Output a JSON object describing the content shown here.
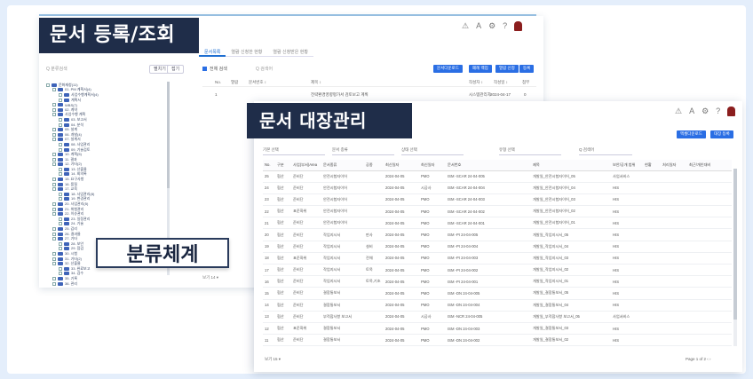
{
  "labels": {
    "doc_register": "문서 등록/조회",
    "doc_ledger": "문서 대장관리",
    "classification": "분류체계"
  },
  "back_window": {
    "tabs": [
      "문서목록",
      "열람 신청한 현황",
      "열람 신청받은 현황"
    ],
    "left_search_placeholder": "Q 분류검색",
    "left_buttons": [
      "펼치기",
      "접기"
    ],
    "toolbar": {
      "select_all": "전체 검색",
      "search_placeholder": "Q 검색어",
      "buttons": [
        "문서다운로드",
        "폐례 백업",
        "열람 신청",
        "등록"
      ]
    },
    "table_headers": [
      "No.",
      "열람",
      "문서번호 ↕",
      "제목 ↕",
      "작성자 ↕",
      "작성일 ↕",
      "첨부"
    ],
    "row": {
      "no": "1",
      "title": "전략환경영향평가서 검토보고 계획",
      "author": "시스템관리자",
      "date": "2024-04-17",
      "att": "0"
    },
    "tree_items": [
      "문화재청(11)",
      "01. PM 계획서(4)",
      "사업수행계획서(4)",
      "계획서",
      "WBS(7)",
      "02. 계약",
      "사업수행 계획",
      "03. 보고서",
      "04. 분석",
      "05. 설계",
      "06. 개발(4)",
      "07. 설계서",
      "08. 사업관리",
      "09. 기술검토",
      "10. 계획(5)",
      "11. 결과",
      "12. 기타(2)",
      "13. 산출물",
      "14. 회의록",
      "15. 요구사항",
      "16. 품질",
      "17. 교육",
      "18. 사업관리(8)",
      "19. 변경관리",
      "20. 사업관리(5)",
      "21. 위험관리",
      "22. 이슈관리",
      "23. 일정관리",
      "24. 기술",
      "25. 감리",
      "26. 결과물",
      "27. 기타",
      "28. 보안",
      "29. 점검",
      "30. 시험",
      "31. 기타(2)",
      "32. 산출물",
      "33. 완료보고",
      "34. 검수",
      "35. 기록",
      "36. 관리"
    ],
    "footer": "보기 14 ▾"
  },
  "header_icons": [
    "⚠",
    "A",
    "⚙",
    "?"
  ],
  "front_window": {
    "buttons": [
      "엑셀다운로드",
      "대장 등록"
    ],
    "filters": [
      "기본 선택",
      "문서 종류",
      "상태 선택",
      "유형 선택"
    ],
    "search_placeholder": "Q 검색어",
    "headers": [
      "No.",
      "구분",
      "사업(부서)Area",
      "문서종류",
      "공종",
      "최신일자",
      "최신일자",
      "문서번호",
      "제목",
      "보안/공개 범위",
      "현황",
      "처리일자",
      "최근/개인대비"
    ],
    "rows": [
      [
        "25",
        "협산",
        "준비단",
        "안전시험자이어",
        "",
        "2024-04-05",
        "PMO",
        "ISM -SCAR 24-04-005",
        "개발일_안전시험자이어_05",
        "사업서비스",
        ""
      ],
      [
        "24",
        "협산",
        "준비단",
        "안전시험자이어",
        "",
        "2024-04-05",
        "시공사",
        "ISM -SCAR 24-04-004",
        "개발일_안전시험자이어_04",
        "HIS",
        ""
      ],
      [
        "23",
        "협산",
        "준비단",
        "안전시험자이어",
        "",
        "2024-04-05",
        "PMO",
        "ISM -SCAR 24-04-003",
        "개발일_안전시험자이어_03",
        "HIS",
        ""
      ],
      [
        "22",
        "협산",
        "표준화위",
        "안전시험자이어",
        "",
        "2024-04-05",
        "PMO",
        "ISM -SCAR 24-04-002",
        "개발일_안전시험자이어_02",
        "HIS",
        ""
      ],
      [
        "21",
        "협산",
        "준비단",
        "안전시험자이어",
        "",
        "2024-04-05",
        "PMO",
        "ISM -SCAR 24-04-001",
        "개발일_안전시험자이어_01",
        "HIS",
        ""
      ],
      [
        "20",
        "협산",
        "준비단",
        "작업지시서",
        "판사",
        "2024-04-05",
        "PMO",
        "ISM -PI 24-04-005",
        "개발일_작업지시서_05",
        "HIS",
        ""
      ],
      [
        "19",
        "협산",
        "준비단",
        "작업지시서",
        "설비",
        "2024-04-05",
        "PMO",
        "ISM -PI 24-04-004",
        "개발일_작업지시서_04",
        "HIS",
        ""
      ],
      [
        "18",
        "협산",
        "표준화위",
        "작업지시서",
        "전체",
        "2024-04-05",
        "PMO",
        "ISM -PI 24-04-003",
        "개발일_작업지시서_03",
        "HIS",
        ""
      ],
      [
        "17",
        "협산",
        "준비단",
        "작업지시서",
        "토목",
        "2024-04-05",
        "PMO",
        "ISM -PI 24-04-002",
        "개발일_작업지시서_02",
        "HIS",
        ""
      ],
      [
        "16",
        "협산",
        "준비단",
        "작업지시서",
        "토목,기초",
        "2024-04-05",
        "PMO",
        "ISM -PI 24-04-001",
        "개발일_작업지시서_01",
        "HIS",
        ""
      ],
      [
        "15",
        "협산",
        "준비단",
        "결함통보서",
        "",
        "2024-04-05",
        "PMO",
        "ISM -DN 24-04-005",
        "개발일_결함통보서_05",
        "HIS",
        ""
      ],
      [
        "14",
        "협산",
        "준비단",
        "결함통보서",
        "",
        "2024-04-05",
        "PMO",
        "ISM -DN 24-04-004",
        "개발일_결함통보서_04",
        "HIS",
        ""
      ],
      [
        "13",
        "협산",
        "준비단",
        "부적합사항 보고서",
        "",
        "2024-04-05",
        "시공사",
        "ISM -NCR 24-04-005",
        "개발일_부적합사항 보고서_05",
        "사업서비스",
        ""
      ],
      [
        "12",
        "협산",
        "표준화위",
        "결함통보서",
        "",
        "2024-04-05",
        "PMO",
        "ISM -DN 24-04-003",
        "개발일_결함통보서_03",
        "HIS",
        ""
      ],
      [
        "11",
        "협산",
        "준비단",
        "결함통보서",
        "",
        "2024-04-05",
        "PMO",
        "ISM -DN 24-04-002",
        "개발일_결함통보서_02",
        "HIS",
        ""
      ]
    ],
    "footer_left": "보기 15 ▾",
    "pagination": "Page 1 of 2  ‹  ›"
  }
}
